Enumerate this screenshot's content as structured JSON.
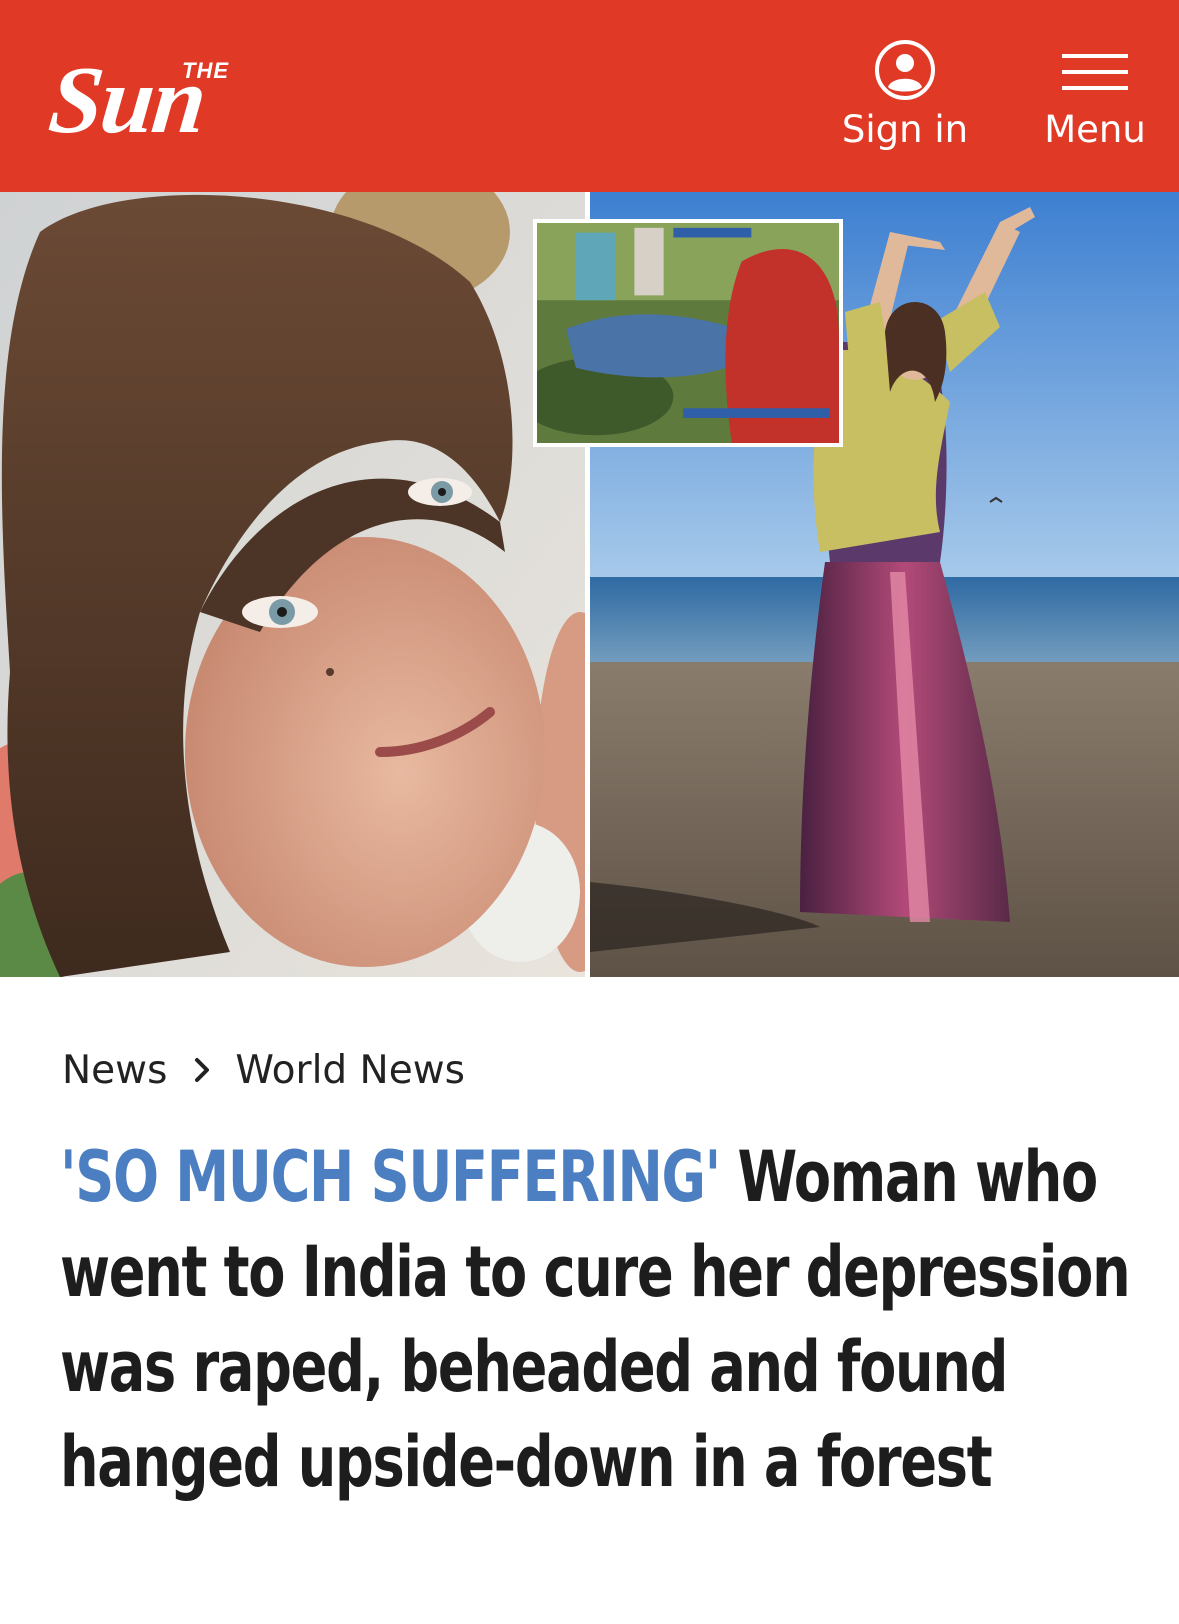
{
  "header": {
    "logo_small": "THE",
    "logo_main": "Sun",
    "sign_in_label": "Sign in",
    "menu_label": "Menu",
    "colors": {
      "brand_red": "#e03a27",
      "text": "#ffffff"
    }
  },
  "hero": {
    "left_image": "woman-portrait-photo",
    "right_image": "woman-on-beach-photo",
    "inset_image": "news-footage-inset"
  },
  "breadcrumb": {
    "items": [
      "News",
      "World News"
    ],
    "separator_icon": "chevron-right-icon"
  },
  "headline": {
    "kicker": "'SO MUCH SUFFERING'",
    "text": "Woman who went to India to cure her depression was raped, beheaded and found hanged upside-down in a forest",
    "kicker_color": "#4b7fc1"
  }
}
